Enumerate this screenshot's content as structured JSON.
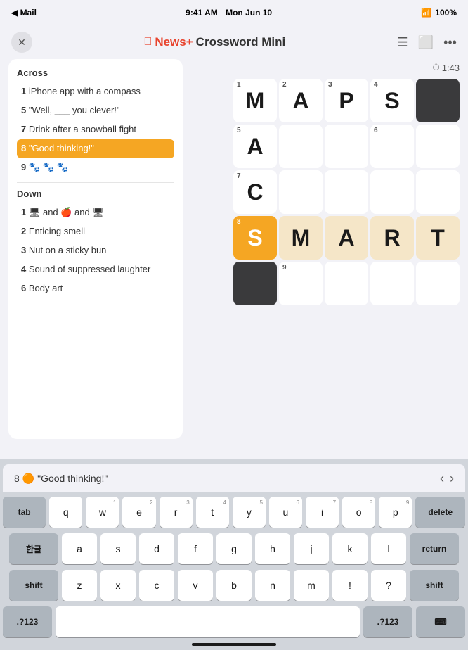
{
  "status_bar": {
    "carrier": "◀ Mail",
    "time": "9:41 AM",
    "date": "Mon Jun 10",
    "wifi": "WiFi",
    "battery": "100%"
  },
  "nav": {
    "title_apple": "",
    "title_newsplus": "News+",
    "title_rest": " Crossword Mini",
    "close_icon": "✕"
  },
  "timer": {
    "label": "1:43",
    "icon": "⏱"
  },
  "clues": {
    "across_title": "Across",
    "across": [
      {
        "number": "1",
        "text": "iPhone app with a compass"
      },
      {
        "number": "5",
        "text": "\"Well, ___ you clever!\""
      },
      {
        "number": "7",
        "text": "Drink after a snowball fight"
      },
      {
        "number": "8",
        "text": "\"Good thinking!\"",
        "active": true
      },
      {
        "number": "9",
        "text": "🐾 🐾 🐾"
      }
    ],
    "down_title": "Down",
    "down": [
      {
        "number": "1",
        "text": "🖥 and 🍎 and 🖥",
        "emoji": true
      },
      {
        "number": "2",
        "text": "Enticing smell"
      },
      {
        "number": "3",
        "text": "Nut on a sticky bun"
      },
      {
        "number": "4",
        "text": "Sound of suppressed laughter"
      },
      {
        "number": "6",
        "text": "Body art"
      }
    ]
  },
  "grid": {
    "cells": [
      {
        "row": 0,
        "col": 0,
        "letter": "M",
        "number": "1",
        "state": "normal"
      },
      {
        "row": 0,
        "col": 1,
        "letter": "A",
        "number": "2",
        "state": "normal"
      },
      {
        "row": 0,
        "col": 2,
        "letter": "P",
        "number": "3",
        "state": "normal"
      },
      {
        "row": 0,
        "col": 3,
        "letter": "S",
        "number": "4",
        "state": "normal"
      },
      {
        "row": 0,
        "col": 4,
        "letter": "",
        "number": "",
        "state": "black"
      },
      {
        "row": 1,
        "col": 0,
        "letter": "A",
        "number": "5",
        "state": "normal"
      },
      {
        "row": 1,
        "col": 1,
        "letter": "",
        "number": "",
        "state": "normal"
      },
      {
        "row": 1,
        "col": 2,
        "letter": "",
        "number": "",
        "state": "normal"
      },
      {
        "row": 1,
        "col": 3,
        "letter": "",
        "number": "6",
        "state": "normal"
      },
      {
        "row": 1,
        "col": 4,
        "letter": "",
        "number": "",
        "state": "normal"
      },
      {
        "row": 2,
        "col": 0,
        "letter": "C",
        "number": "7",
        "state": "normal"
      },
      {
        "row": 2,
        "col": 1,
        "letter": "",
        "number": "",
        "state": "normal"
      },
      {
        "row": 2,
        "col": 2,
        "letter": "",
        "number": "",
        "state": "normal"
      },
      {
        "row": 2,
        "col": 3,
        "letter": "",
        "number": "",
        "state": "normal"
      },
      {
        "row": 2,
        "col": 4,
        "letter": "",
        "number": "",
        "state": "normal"
      },
      {
        "row": 3,
        "col": 0,
        "letter": "S",
        "number": "8",
        "state": "active"
      },
      {
        "row": 3,
        "col": 1,
        "letter": "M",
        "number": "",
        "state": "highlighted"
      },
      {
        "row": 3,
        "col": 2,
        "letter": "A",
        "number": "",
        "state": "highlighted"
      },
      {
        "row": 3,
        "col": 3,
        "letter": "R",
        "number": "",
        "state": "highlighted"
      },
      {
        "row": 3,
        "col": 4,
        "letter": "T",
        "number": "",
        "state": "highlighted"
      },
      {
        "row": 4,
        "col": 0,
        "letter": "",
        "number": "",
        "state": "black"
      },
      {
        "row": 4,
        "col": 1,
        "letter": "",
        "number": "9",
        "state": "normal"
      },
      {
        "row": 4,
        "col": 2,
        "letter": "",
        "number": "",
        "state": "normal"
      },
      {
        "row": 4,
        "col": 3,
        "letter": "",
        "number": "",
        "state": "normal"
      },
      {
        "row": 4,
        "col": 4,
        "letter": "",
        "number": "",
        "state": "normal"
      }
    ]
  },
  "clue_hint": {
    "number": "8",
    "emoji": "🟠",
    "text": "\"Good thinking!\""
  },
  "keyboard": {
    "row1": [
      {
        "label": "tab",
        "special": true
      },
      {
        "label": "q",
        "num": ""
      },
      {
        "label": "w",
        "num": "1"
      },
      {
        "label": "e",
        "num": "2"
      },
      {
        "label": "r",
        "num": "3"
      },
      {
        "label": "t",
        "num": "4"
      },
      {
        "label": "y",
        "num": "5"
      },
      {
        "label": "u",
        "num": "6"
      },
      {
        "label": "i",
        "num": "7"
      },
      {
        "label": "o",
        "num": "8"
      },
      {
        "label": "p",
        "num": "9"
      },
      {
        "label": "delete",
        "special": true
      }
    ],
    "row2": [
      {
        "label": "한글",
        "special": true
      },
      {
        "label": "a",
        "num": ""
      },
      {
        "label": "s",
        "num": ""
      },
      {
        "label": "d",
        "num": ""
      },
      {
        "label": "f",
        "num": ""
      },
      {
        "label": "g",
        "num": ""
      },
      {
        "label": "h",
        "num": ""
      },
      {
        "label": "j",
        "num": ""
      },
      {
        "label": "k",
        "num": ""
      },
      {
        "label": "l",
        "num": ""
      },
      {
        "label": "return",
        "special": true
      }
    ],
    "row3": [
      {
        "label": "shift",
        "special": true
      },
      {
        "label": "z",
        "num": ""
      },
      {
        "label": "x",
        "num": ""
      },
      {
        "label": "c",
        "num": ""
      },
      {
        "label": "v",
        "num": ""
      },
      {
        "label": "b",
        "num": ""
      },
      {
        "label": "n",
        "num": ""
      },
      {
        "label": "m",
        "num": ""
      },
      {
        "label": "!",
        "num": ""
      },
      {
        "label": "?",
        "num": ""
      },
      {
        "label": "shift",
        "special": true
      }
    ],
    "row4": [
      {
        "label": ".?123",
        "special": true
      },
      {
        "label": "space",
        "space": true
      },
      {
        "label": ".?123",
        "special": true
      },
      {
        "label": "⌨",
        "special": true
      }
    ]
  }
}
